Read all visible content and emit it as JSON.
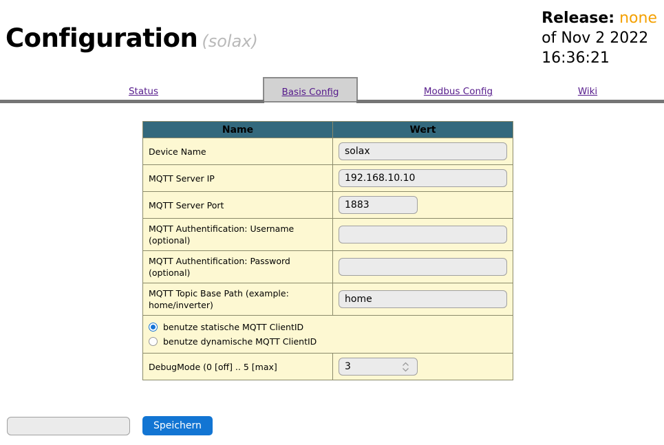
{
  "header": {
    "title": "Configuration",
    "device": "(solax)",
    "release_label": "Release:",
    "release_value": "none",
    "release_date": "of Nov 2 2022",
    "release_time": "16:36:21"
  },
  "tabs": [
    {
      "label": "Status",
      "active": false
    },
    {
      "label": "Basis Config",
      "active": true
    },
    {
      "label": "Modbus Config",
      "active": false
    },
    {
      "label": "Wiki",
      "active": false
    }
  ],
  "table": {
    "headers": {
      "name": "Name",
      "value": "Wert"
    },
    "rows": [
      {
        "name": "Device Name",
        "value": "solax",
        "placeholder": "",
        "field": "text",
        "width": "wide"
      },
      {
        "name": "MQTT Server IP",
        "value": "192.168.10.10",
        "placeholder": "",
        "field": "text",
        "width": "wide"
      },
      {
        "name": "MQTT Server Port",
        "value": "1883",
        "placeholder": "",
        "field": "text",
        "width": "narrow"
      },
      {
        "name": "MQTT Authentification: Username (optional)",
        "value": "",
        "placeholder": "",
        "field": "text",
        "width": "wide"
      },
      {
        "name": "MQTT Authentification: Password (optional)",
        "value": "",
        "placeholder": "",
        "field": "text",
        "width": "wide"
      },
      {
        "name": "MQTT Topic Base Path (example: home/inverter)",
        "value": "home",
        "placeholder": "",
        "field": "text",
        "width": "wide"
      }
    ],
    "radios": [
      {
        "label": "benutze statische MQTT ClientID",
        "selected": true
      },
      {
        "label": "benutze dynamische MQTT ClientID",
        "selected": false
      }
    ],
    "debug": {
      "name": "DebugMode (0 [off] .. 5 [max]",
      "value": "3"
    }
  },
  "footer": {
    "input_value": "",
    "input_placeholder": "",
    "save_label": "Speichern"
  },
  "colors": {
    "header_teal": "#33697d",
    "row_yellow": "#fdf8d2",
    "link_purple": "#551a8b",
    "release_orange": "#f4a000",
    "button_blue": "#1275d3",
    "active_tab_gray": "#d2d2d2"
  }
}
